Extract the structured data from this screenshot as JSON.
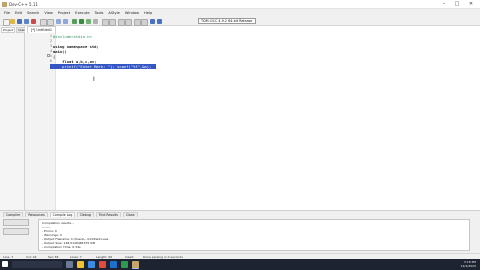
{
  "window": {
    "title": "Dev-C++ 5.11",
    "colors": {
      "selection": "#3457c4",
      "taskbar": "#1d2330"
    }
  },
  "menu": {
    "items": [
      "File",
      "Edit",
      "Search",
      "View",
      "Project",
      "Execute",
      "Tools",
      "AStyle",
      "Window",
      "Help"
    ]
  },
  "toolbar": {
    "compiler": "TDM-GCC 4.9.2 64-bit Release",
    "globals": "(globals)"
  },
  "side_panel": {
    "tabs": [
      "Project",
      "Classes",
      "Debug"
    ]
  },
  "editor": {
    "file_tab": "[*] Untitled1",
    "lines": [
      {
        "n": "1",
        "text": "#include<stdio.h>"
      },
      {
        "n": "2",
        "text": ""
      },
      {
        "n": "3",
        "text": "using namespace std;"
      },
      {
        "n": "4",
        "text": "main()"
      },
      {
        "n": "5",
        "text": "{"
      },
      {
        "n": "6",
        "text": "    float a,b,c,av;"
      },
      {
        "n": "7",
        "text": "    printf(\"Enter Mark: \"); scanf(\"%f\",&a);"
      }
    ]
  },
  "bottom_panel": {
    "tabs": [
      "Compiler",
      "Resources",
      "Compile Log",
      "Debug",
      "Find Results",
      "Close"
    ],
    "log": [
      "Compilation results...",
      "--------",
      "- Errors: 0",
      "- Warnings: 0",
      "- Output Filename: C:\\Users\\...\\Untitled1.exe",
      "- Output Size: 128.0146484375 KiB",
      "- Compilation Time: 0.34s"
    ]
  },
  "status_bar": {
    "line": "Line: 7",
    "col": "Col: 42",
    "sel": "Sel: 38",
    "lines": "Lines: 7",
    "length": "Length: 96",
    "mode": "Insert",
    "message": "Done parsing in 0 seconds"
  },
  "taskbar": {
    "time": "3:18 PM",
    "date": "12/4/2020"
  }
}
